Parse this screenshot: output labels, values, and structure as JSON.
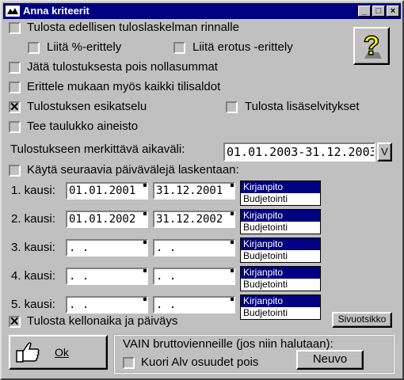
{
  "window": {
    "title": "Anna kriteerit",
    "minimize": "_",
    "maximize": "□",
    "close": "×"
  },
  "options": {
    "prev_year": "Tulosta edellisen tuloslaskelman rinnalle",
    "percent": "Liitä %-erittely",
    "difference": "Liitä erotus -erittely",
    "zero_sums": "Jätä tulostuksesta pois nollasummat",
    "all_balances": "Erittele mukaan myös kaikki tilisaldot",
    "preview": "Tulostuksen esikatselu",
    "extra_info": "Tulosta lisäselvitykset",
    "spreadsheet": "Tee taulukko aineisto",
    "print_time": "Tulosta kellonaika ja päiväys"
  },
  "checked": {
    "prev_year": false,
    "percent": false,
    "difference": false,
    "zero_sums": false,
    "all_balances": false,
    "preview": true,
    "extra_info": false,
    "spreadsheet": false,
    "use_periods": false,
    "print_time": true,
    "vat": false
  },
  "interval": {
    "label": "Tulostukseen merkittävä aikaväli:",
    "value": "01.01.2003-31.12.2003",
    "dropdown": "V"
  },
  "periods_label": "Käytä seuraavia päivävälejä laskentaan:",
  "periods": [
    {
      "label": "1. kausi:",
      "start": "01.01.2001",
      "end": "31.12.2001",
      "options": [
        "Kirjanpito",
        "Budjetointi"
      ],
      "selected": 0
    },
    {
      "label": "2. kausi:",
      "start": "01.01.2002",
      "end": "31.12.2002",
      "options": [
        "Kirjanpito",
        "Budjetointi"
      ],
      "selected": 0
    },
    {
      "label": "3. kausi:",
      "start": "  .  .",
      "end": "  .  .",
      "options": [
        "Kirjanpito",
        "Budjetointi"
      ],
      "selected": 0
    },
    {
      "label": "4. kausi:",
      "start": "  .  .",
      "end": "  .  .",
      "options": [
        "Kirjanpito",
        "Budjetointi"
      ],
      "selected": 0
    },
    {
      "label": "5. kausi:",
      "start": "  .  .",
      "end": "  .  .",
      "options": [
        "Kirjanpito",
        "Budjetointi"
      ],
      "selected": 0
    }
  ],
  "buttons": {
    "header": "Sivuotsikko",
    "ok": "Ok",
    "new": "Neuvo"
  },
  "gross": {
    "label": "VAIN bruttovienneille (jos niin halutaan):",
    "vat": "Kuori Alv osuudet pois"
  },
  "icons": {
    "help": "question-mark-icon",
    "ok": "thumbs-up-hand-icon",
    "app": "app-icon"
  }
}
